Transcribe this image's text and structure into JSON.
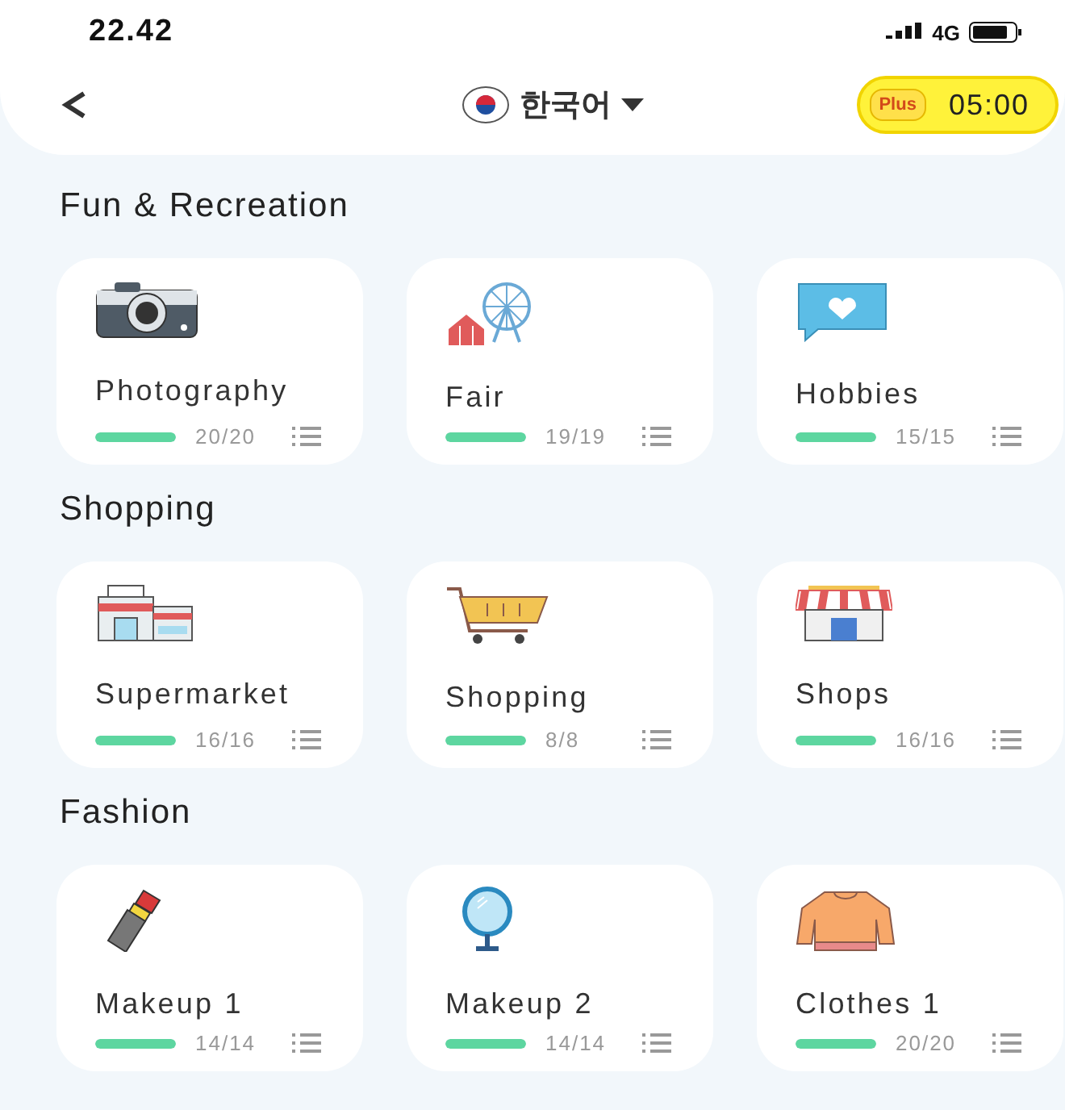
{
  "status_bar": {
    "time": "22.42",
    "network": "4G"
  },
  "header": {
    "language": "한국어",
    "plus_badge": "Plus",
    "timer": "05:00"
  },
  "sections": [
    {
      "title": "Fun & Recreation",
      "items": [
        {
          "title": "Photography",
          "count": "20/20",
          "level": 1
        },
        {
          "title": "Fair",
          "count": "19/19",
          "level": 1
        },
        {
          "title": "Hobbies",
          "count": "15/15",
          "level": 1
        }
      ]
    },
    {
      "title": "Shopping",
      "items": [
        {
          "title": "Supermarket",
          "count": "16/16",
          "level": 1
        },
        {
          "title": "Shopping",
          "count": "8/8",
          "level": 1
        },
        {
          "title": "Shops",
          "count": "16/16",
          "level": 1
        }
      ]
    },
    {
      "title": "Fashion",
      "items": [
        {
          "title": "Makeup 1",
          "count": "14/14",
          "level": 1
        },
        {
          "title": "Makeup 2",
          "count": "14/14",
          "level": 1
        },
        {
          "title": "Clothes 1",
          "count": "20/20",
          "level": 1
        }
      ]
    }
  ]
}
